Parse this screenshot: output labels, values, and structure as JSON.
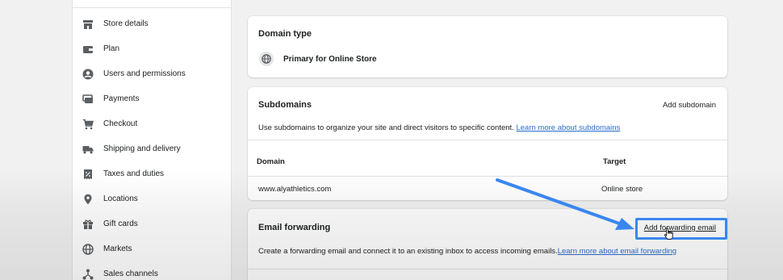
{
  "sidebar": {
    "items": [
      {
        "label": "Store details",
        "icon": "store-icon"
      },
      {
        "label": "Plan",
        "icon": "wallet-icon"
      },
      {
        "label": "Users and permissions",
        "icon": "user-icon"
      },
      {
        "label": "Payments",
        "icon": "payments-icon"
      },
      {
        "label": "Checkout",
        "icon": "cart-icon"
      },
      {
        "label": "Shipping and delivery",
        "icon": "truck-icon"
      },
      {
        "label": "Taxes and duties",
        "icon": "percent-icon"
      },
      {
        "label": "Locations",
        "icon": "location-pin-icon"
      },
      {
        "label": "Gift cards",
        "icon": "gift-icon"
      },
      {
        "label": "Markets",
        "icon": "globe-icon"
      },
      {
        "label": "Sales channels",
        "icon": "channels-icon"
      }
    ]
  },
  "domain_type": {
    "title": "Domain type",
    "value": "Primary for Online Store",
    "icon": "globe-icon"
  },
  "subdomains": {
    "title": "Subdomains",
    "action": "Add subdomain",
    "description": "Use subdomains to organize your site and direct visitors to specific content.",
    "learn_more": "Learn more about subdomains",
    "columns": [
      "Domain",
      "Target"
    ],
    "rows": [
      {
        "domain": "www.alyathletics.com",
        "target": "Online store"
      }
    ]
  },
  "email_forwarding": {
    "title": "Email forwarding",
    "action": "Add forwarding email",
    "description": "Create a forwarding email and connect it to an existing inbox to access incoming emails.",
    "learn_more": "Learn more about email forwarding"
  },
  "annotation": {
    "arrow_color": "#3a86f0",
    "link_color": "#2c6ecb"
  }
}
